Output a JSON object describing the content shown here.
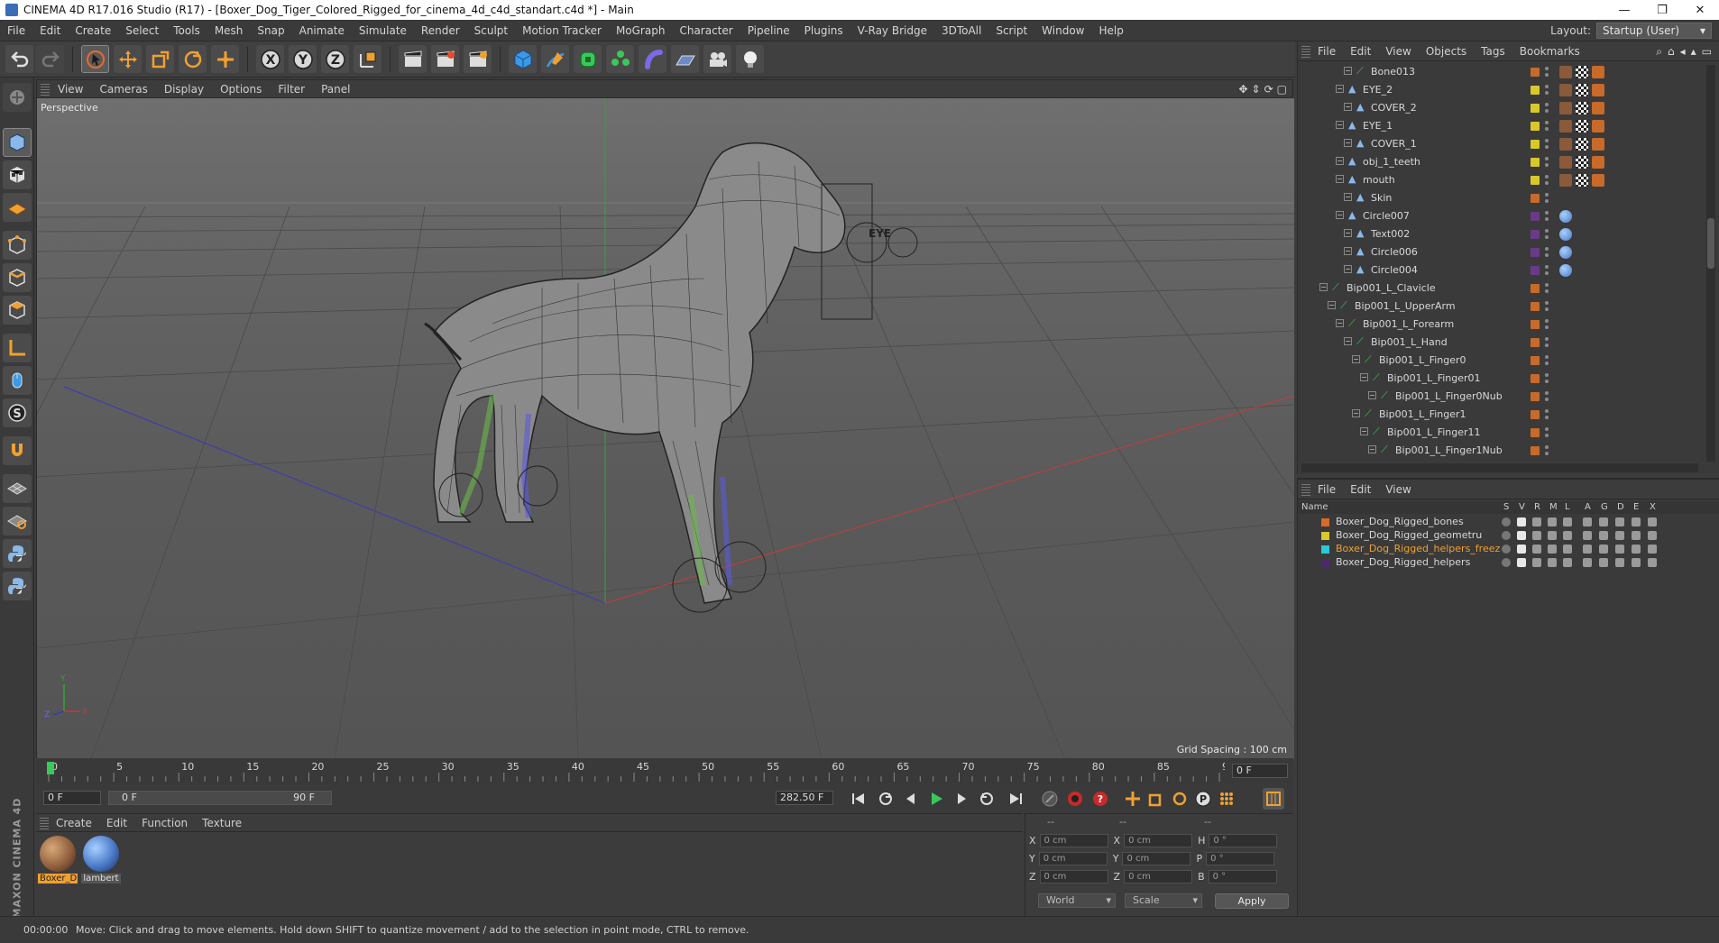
{
  "window": {
    "title": "CINEMA 4D R17.016 Studio (R17) - [Boxer_Dog_Tiger_Colored_Rigged_for_cinema_4d_c4d_standart.c4d *] - Main",
    "minimize": "—",
    "restore": "❐",
    "close": "✕"
  },
  "menubar": [
    "File",
    "Edit",
    "Create",
    "Select",
    "Tools",
    "Mesh",
    "Snap",
    "Animate",
    "Simulate",
    "Render",
    "Sculpt",
    "Motion Tracker",
    "MoGraph",
    "Character",
    "Pipeline",
    "Plugins",
    "V-Ray Bridge",
    "3DToAll",
    "Script",
    "Window",
    "Help"
  ],
  "layout": {
    "label": "Layout:",
    "value": "Startup (User)"
  },
  "viewport": {
    "menu": [
      "View",
      "Cameras",
      "Display",
      "Options",
      "Filter",
      "Panel"
    ],
    "label": "Perspective",
    "grid_spacing": "Grid Spacing : 100 cm",
    "nav_icons": [
      "✥",
      "⇕",
      "⟳",
      "▢"
    ],
    "axis": {
      "y": "Y",
      "x": "X",
      "z": "Z"
    }
  },
  "timeline": {
    "ticks": [
      "0",
      "5",
      "10",
      "15",
      "20",
      "25",
      "30",
      "35",
      "40",
      "45",
      "50",
      "55",
      "60",
      "65",
      "70",
      "75",
      "80",
      "85",
      "90"
    ],
    "current_frame": "0 F",
    "start_field": "0 F",
    "range_start": "0 F",
    "range_end": "90 F",
    "end_field": "282.50 F"
  },
  "material_manager": {
    "menu": [
      "Create",
      "Edit",
      "Function",
      "Texture"
    ],
    "materials": [
      {
        "label": "Boxer_D",
        "color": "#8a5a3a"
      },
      {
        "label": "lambert",
        "color": "#4a7ac8"
      }
    ]
  },
  "coordinates": {
    "header": [
      "--",
      "--",
      "--"
    ],
    "rows": [
      {
        "a": "X",
        "av": "0 cm",
        "b": "X",
        "bv": "0 cm",
        "c": "H",
        "cv": "0 °"
      },
      {
        "a": "Y",
        "av": "0 cm",
        "b": "Y",
        "bv": "0 cm",
        "c": "P",
        "cv": "0 °"
      },
      {
        "a": "Z",
        "av": "0 cm",
        "b": "Z",
        "bv": "0 cm",
        "c": "B",
        "cv": "0 °"
      }
    ],
    "world": "World",
    "scale": "Scale",
    "apply": "Apply"
  },
  "status": {
    "time": "00:00:00",
    "message": "Move: Click and drag to move elements. Hold down SHIFT to quantize movement / add to the selection in point mode, CTRL to remove."
  },
  "object_manager": {
    "menu": [
      "File",
      "Edit",
      "View",
      "Objects",
      "Tags",
      "Bookmarks"
    ],
    "rows": [
      {
        "name": "Bone013",
        "indent": 5,
        "chip": "#c86a2a"
      },
      {
        "name": "EYE_2",
        "indent": 4,
        "chip": "#d8c82a"
      },
      {
        "name": "COVER_2",
        "indent": 5,
        "chip": "#d8c82a"
      },
      {
        "name": "EYE_1",
        "indent": 4,
        "chip": "#d8c82a"
      },
      {
        "name": "COVER_1",
        "indent": 5,
        "chip": "#d8c82a"
      },
      {
        "name": "obj_1_teeth",
        "indent": 4,
        "chip": "#d8c82a"
      },
      {
        "name": "mouth",
        "indent": 4,
        "chip": "#d8c82a"
      },
      {
        "name": "Skin",
        "indent": 5,
        "chip": "#c86a2a"
      },
      {
        "name": "Circle007",
        "indent": 4,
        "chip": "#6a3a8a"
      },
      {
        "name": "Text002",
        "indent": 5,
        "chip": "#6a3a8a"
      },
      {
        "name": "Circle006",
        "indent": 5,
        "chip": "#6a3a8a"
      },
      {
        "name": "Circle004",
        "indent": 5,
        "chip": "#6a3a8a"
      },
      {
        "name": "Bip001_L_Clavicle",
        "indent": 2,
        "chip": "#c86a2a"
      },
      {
        "name": "Bip001_L_UpperArm",
        "indent": 3,
        "chip": "#c86a2a"
      },
      {
        "name": "Bip001_L_Forearm",
        "indent": 4,
        "chip": "#c86a2a"
      },
      {
        "name": "Bip001_L_Hand",
        "indent": 5,
        "chip": "#c86a2a"
      },
      {
        "name": "Bip001_L_Finger0",
        "indent": 6,
        "chip": "#c86a2a"
      },
      {
        "name": "Bip001_L_Finger01",
        "indent": 7,
        "chip": "#c86a2a"
      },
      {
        "name": "Bip001_L_Finger0Nub",
        "indent": 8,
        "chip": "#c86a2a"
      },
      {
        "name": "Bip001_L_Finger1",
        "indent": 6,
        "chip": "#c86a2a"
      },
      {
        "name": "Bip001_L_Finger11",
        "indent": 7,
        "chip": "#c86a2a"
      },
      {
        "name": "Bip001_L_Finger1Nub",
        "indent": 8,
        "chip": "#c86a2a"
      }
    ]
  },
  "layer_manager": {
    "menu": [
      "File",
      "Edit",
      "View"
    ],
    "columns": [
      "Name",
      "S",
      "V",
      "R",
      "M",
      "L",
      "A",
      "G",
      "D",
      "E",
      "X"
    ],
    "layers": [
      {
        "name": "Boxer_Dog_Rigged_bones",
        "color": "#d86a2a",
        "highlight": false
      },
      {
        "name": "Boxer_Dog_Rigged_geometru",
        "color": "#d8c82a",
        "highlight": false
      },
      {
        "name": "Boxer_Dog_Rigged_helpers_freez",
        "color": "#2ac8d8",
        "highlight": true
      },
      {
        "name": "Boxer_Dog_Rigged_helpers",
        "color": "#4a2a6a",
        "highlight": false
      }
    ]
  },
  "colors": {
    "accent": "#f0a030",
    "highlight_text": "#f0a030",
    "viewport_bg": "#5a5a5a"
  }
}
